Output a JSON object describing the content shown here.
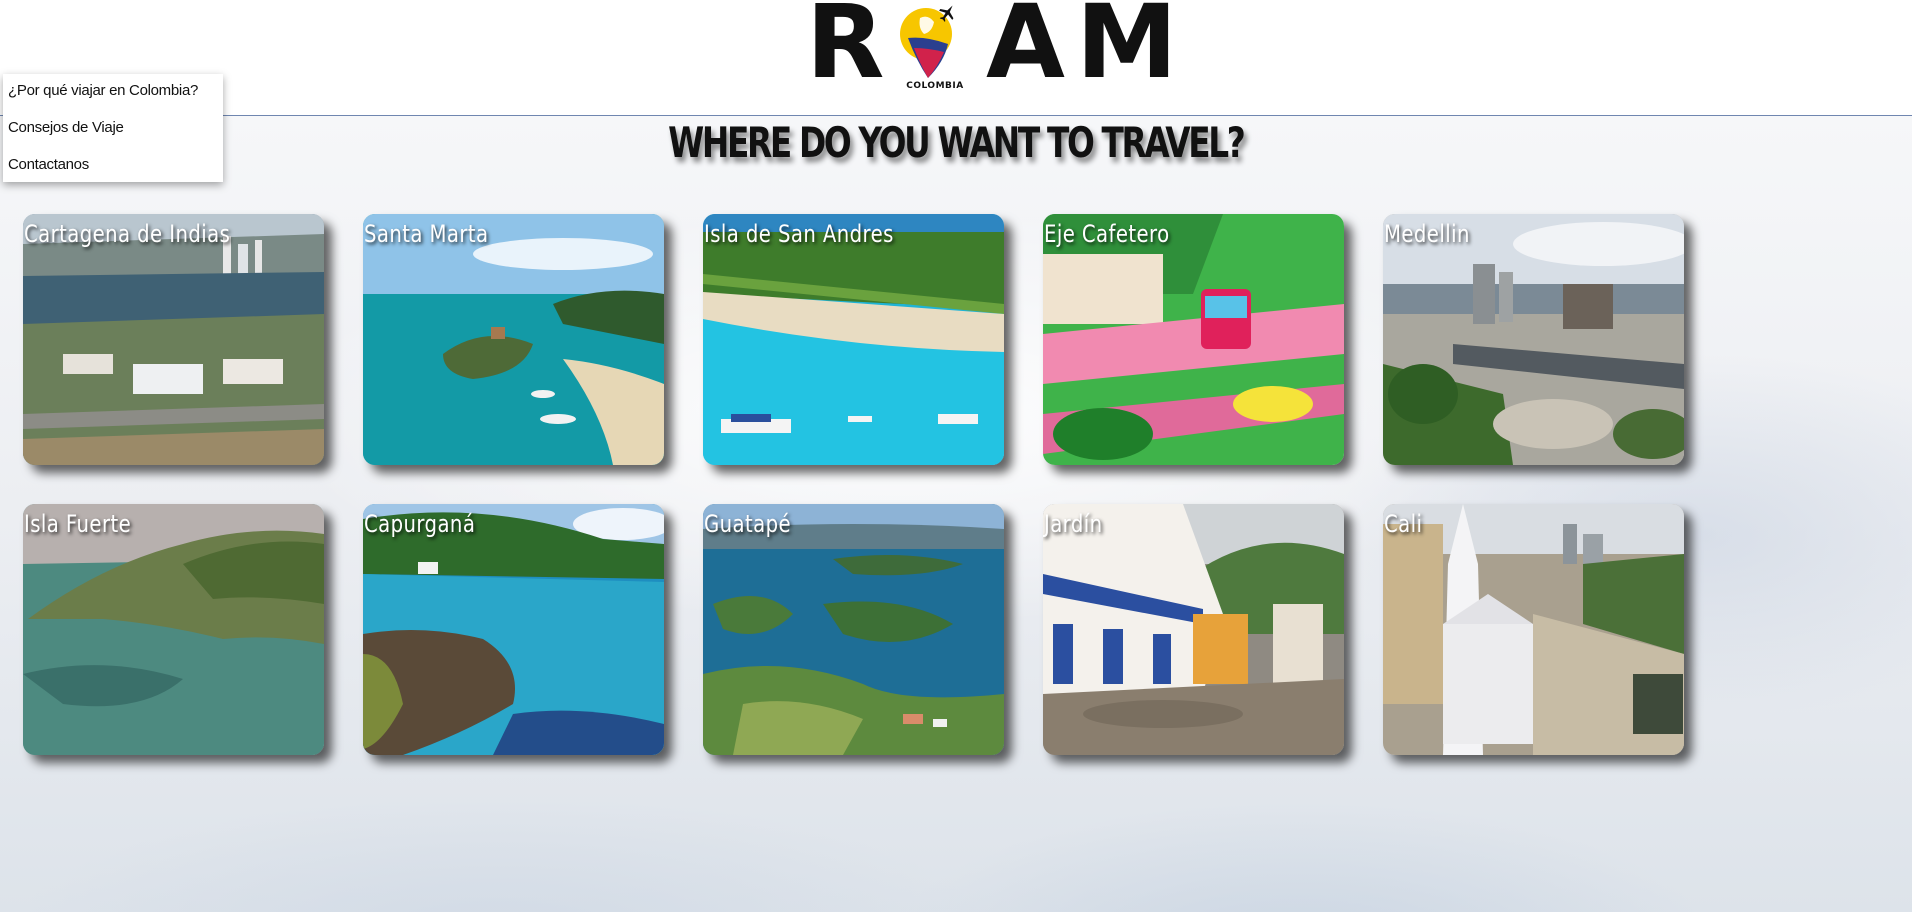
{
  "brand": {
    "logo_letters": [
      "R",
      "A",
      "M"
    ],
    "logo_subtitle": "COLOMBIA"
  },
  "nav": {
    "items": [
      {
        "label": "¿Por qué viajar en Colombia?"
      },
      {
        "label": "Consejos de Viaje"
      },
      {
        "label": "Contactanos"
      }
    ]
  },
  "main": {
    "title": "WHERE DO YOU WANT TO TRAVEL?",
    "destinations": [
      {
        "label": "Cartagena de Indias",
        "scene": "city-bay"
      },
      {
        "label": "Santa Marta",
        "scene": "rocky-coast"
      },
      {
        "label": "Isla de San Andres",
        "scene": "beach-boats"
      },
      {
        "label": "Eje Cafetero",
        "scene": "colorful-park"
      },
      {
        "label": "Medellin",
        "scene": "city-train"
      },
      {
        "label": "Isla Fuerte",
        "scene": "island-aerial"
      },
      {
        "label": "Capurganá",
        "scene": "tropical-cove"
      },
      {
        "label": "Guatapé",
        "scene": "lake-islands"
      },
      {
        "label": "Jardín",
        "scene": "colonial-street"
      },
      {
        "label": "Cali",
        "scene": "church-plaza"
      }
    ]
  },
  "colors": {
    "header_border": "#6f86b0",
    "logo_yellow": "#f7c600",
    "logo_blue": "#2a3f8f",
    "logo_red": "#d1224b"
  }
}
